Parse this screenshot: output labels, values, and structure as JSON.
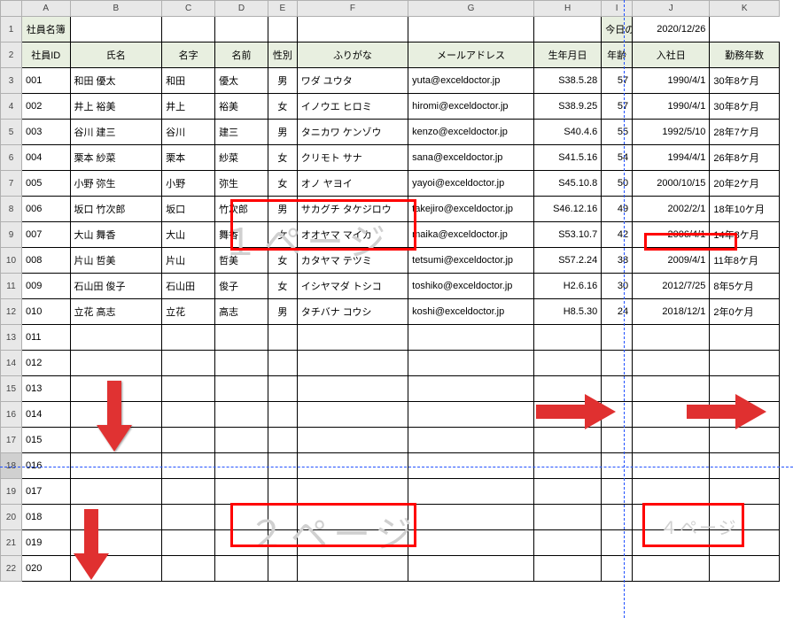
{
  "columns": [
    "A",
    "B",
    "C",
    "D",
    "E",
    "F",
    "G",
    "H",
    "I",
    "J",
    "K"
  ],
  "row_numbers": [
    "1",
    "2",
    "3",
    "4",
    "5",
    "6",
    "7",
    "8",
    "9",
    "10",
    "11",
    "12",
    "13",
    "14",
    "15",
    "16",
    "17",
    "18",
    "19",
    "20",
    "21",
    "22"
  ],
  "title": "社員名簿",
  "today_label": "今日の日付",
  "today_value": "2020/12/26",
  "headers": {
    "id": "社員ID",
    "name": "氏名",
    "surname": "名字",
    "given": "名前",
    "gender": "性別",
    "kana": "ふりがな",
    "email": "メールアドレス",
    "birth": "生年月日",
    "age": "年齢",
    "hire": "入社日",
    "years": "勤務年数"
  },
  "rows": [
    {
      "id": "001",
      "name": "和田 優太",
      "sur": "和田",
      "giv": "優太",
      "sex": "男",
      "kana": "ワダ ユウタ",
      "mail": "yuta@exceldoctor.jp",
      "birth": "S38.5.28",
      "age": "57",
      "hire": "1990/4/1",
      "yrs": "30年8ケ月"
    },
    {
      "id": "002",
      "name": "井上 裕美",
      "sur": "井上",
      "giv": "裕美",
      "sex": "女",
      "kana": "イノウエ ヒロミ",
      "mail": "hiromi@exceldoctor.jp",
      "birth": "S38.9.25",
      "age": "57",
      "hire": "1990/4/1",
      "yrs": "30年8ケ月"
    },
    {
      "id": "003",
      "name": "谷川 建三",
      "sur": "谷川",
      "giv": "建三",
      "sex": "男",
      "kana": "タニカワ ケンゾウ",
      "mail": "kenzo@exceldoctor.jp",
      "birth": "S40.4.6",
      "age": "55",
      "hire": "1992/5/10",
      "yrs": "28年7ケ月"
    },
    {
      "id": "004",
      "name": "栗本 紗菜",
      "sur": "栗本",
      "giv": "紗菜",
      "sex": "女",
      "kana": "クリモト サナ",
      "mail": "sana@exceldoctor.jp",
      "birth": "S41.5.16",
      "age": "54",
      "hire": "1994/4/1",
      "yrs": "26年8ケ月"
    },
    {
      "id": "005",
      "name": "小野 弥生",
      "sur": "小野",
      "giv": "弥生",
      "sex": "女",
      "kana": "オノ ヤヨイ",
      "mail": "yayoi@exceldoctor.jp",
      "birth": "S45.10.8",
      "age": "50",
      "hire": "2000/10/15",
      "yrs": "20年2ケ月"
    },
    {
      "id": "006",
      "name": "坂口 竹次郎",
      "sur": "坂口",
      "giv": "竹次郎",
      "sex": "男",
      "kana": "サカグチ タケジロウ",
      "mail": "takejiro@exceldoctor.jp",
      "birth": "S46.12.16",
      "age": "49",
      "hire": "2002/2/1",
      "yrs": "18年10ケ月"
    },
    {
      "id": "007",
      "name": "大山 舞香",
      "sur": "大山",
      "giv": "舞香",
      "sex": "女",
      "kana": "オオヤマ マイカ",
      "mail": "maika@exceldoctor.jp",
      "birth": "S53.10.7",
      "age": "42",
      "hire": "2006/4/1",
      "yrs": "14年8ケ月"
    },
    {
      "id": "008",
      "name": "片山 哲美",
      "sur": "片山",
      "giv": "哲美",
      "sex": "女",
      "kana": "カタヤマ テツミ",
      "mail": "tetsumi@exceldoctor.jp",
      "birth": "S57.2.24",
      "age": "38",
      "hire": "2009/4/1",
      "yrs": "11年8ケ月"
    },
    {
      "id": "009",
      "name": "石山田 俊子",
      "sur": "石山田",
      "giv": "俊子",
      "sex": "女",
      "kana": "イシヤマダ トシコ",
      "mail": "toshiko@exceldoctor.jp",
      "birth": "H2.6.16",
      "age": "30",
      "hire": "2012/7/25",
      "yrs": "8年5ケ月"
    },
    {
      "id": "010",
      "name": "立花 高志",
      "sur": "立花",
      "giv": "高志",
      "sex": "男",
      "kana": "タチバナ コウシ",
      "mail": "koshi@exceldoctor.jp",
      "birth": "H8.5.30",
      "age": "24",
      "hire": "2018/12/1",
      "yrs": "2年0ケ月"
    }
  ],
  "empty_ids": [
    "011",
    "012",
    "013",
    "014",
    "015",
    "016",
    "017",
    "018",
    "019",
    "020"
  ],
  "watermarks": {
    "p1": "１ページ",
    "p2": "２ページ",
    "p4": "４ページ"
  }
}
